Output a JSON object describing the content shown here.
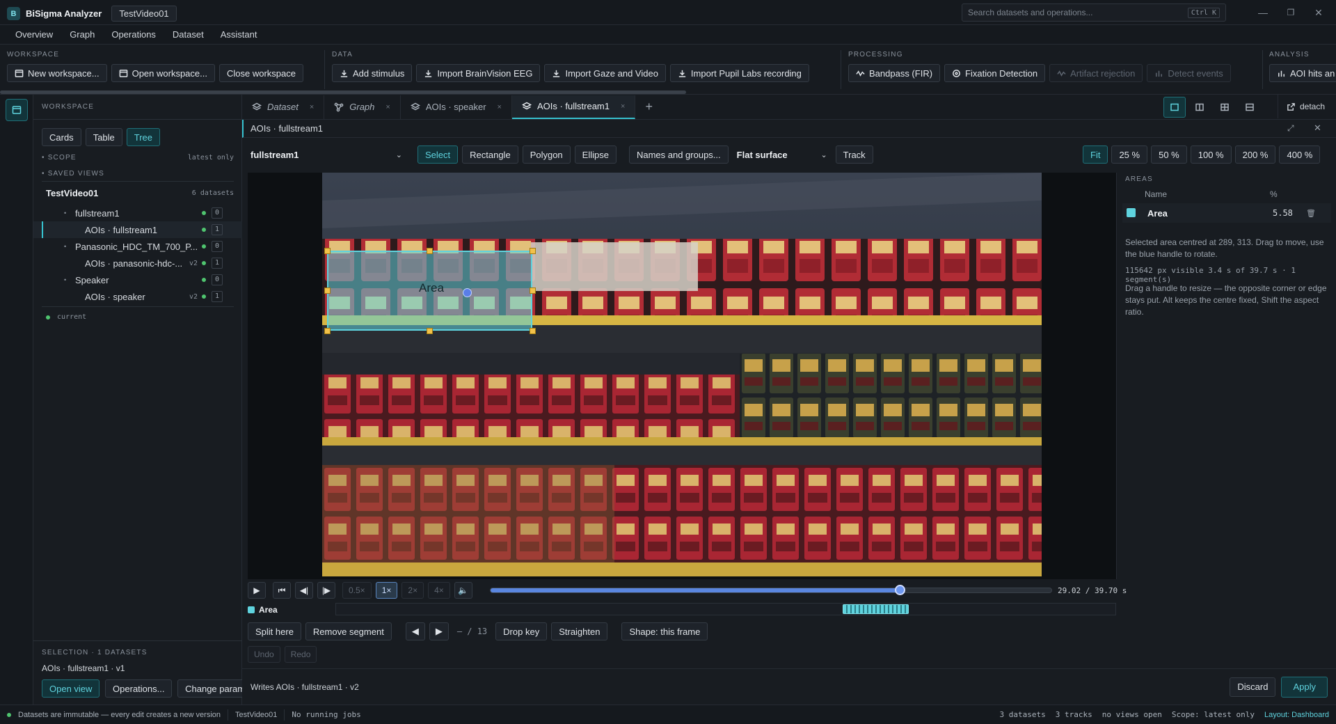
{
  "app": {
    "logo": "B",
    "name": "BiSigma Analyzer",
    "project": "TestVideo01",
    "search_placeholder": "Search datasets and operations...",
    "search_shortcut": "Ctrl K"
  },
  "menu": [
    "Overview",
    "Graph",
    "Operations",
    "Dataset",
    "Assistant"
  ],
  "toolbar": {
    "workspace": {
      "label": "WORKSPACE",
      "buttons": [
        "New workspace...",
        "Open workspace...",
        "Close workspace"
      ]
    },
    "data": {
      "label": "DATA",
      "buttons": [
        "Add stimulus",
        "Import BrainVision EEG",
        "Import Gaze and Video",
        "Import Pupil Labs recording"
      ]
    },
    "processing": {
      "label": "PROCESSING",
      "buttons": [
        "Bandpass (FIR)",
        "Fixation Detection",
        "Artifact rejection",
        "Detect events"
      ]
    },
    "analysis": {
      "label": "ANALYSIS",
      "buttons": [
        "AOI hits an"
      ]
    }
  },
  "sidebar": {
    "label": "WORKSPACE",
    "view_tabs": [
      "Cards",
      "Table",
      "Tree"
    ],
    "scope_label": "SCOPE",
    "scope_value": "latest only",
    "saved_views_label": "SAVED VIEWS",
    "root": {
      "name": "TestVideo01",
      "count": "6 datasets"
    },
    "items": [
      {
        "name": "fullstream1",
        "level": 1,
        "version": "",
        "count": "0"
      },
      {
        "name": "AOIs · fullstream1",
        "level": 2,
        "version": "",
        "count": "1"
      },
      {
        "name": "Panasonic_HDC_TM_700_P...",
        "level": 1,
        "version": "",
        "count": "0"
      },
      {
        "name": "AOIs · panasonic-hdc-...",
        "level": 2,
        "version": "v2",
        "count": "1"
      },
      {
        "name": "Speaker",
        "level": 1,
        "version": "",
        "count": "0"
      },
      {
        "name": "AOIs · speaker",
        "level": 2,
        "version": "v2",
        "count": "1"
      }
    ],
    "legend": "current",
    "selection_label": "SELECTION · 1 DATASETS",
    "selection_item": "AOIs · fullstream1 · v1",
    "selection_buttons": [
      "Open view",
      "Operations...",
      "Change param"
    ]
  },
  "tabs": [
    {
      "label": "Dataset",
      "icon": "layers-icon"
    },
    {
      "label": "Graph",
      "icon": "graph-icon"
    },
    {
      "label": "AOIs · speaker",
      "icon": "layers-icon"
    },
    {
      "label": "AOIs · fullstream1",
      "icon": "layers-icon"
    }
  ],
  "tab_detach": "detach",
  "panel": {
    "title": "AOIs · fullstream1",
    "stream_select": "fullstream1",
    "tools": [
      "Select",
      "Rectangle",
      "Polygon",
      "Ellipse"
    ],
    "names_button": "Names and groups...",
    "surface_select": "Flat surface",
    "track_button": "Track",
    "zoom": [
      "Fit",
      "25 %",
      "50 %",
      "100 %",
      "200 %",
      "400 %"
    ]
  },
  "aoi": {
    "label": "Area",
    "color": "#5fd3de"
  },
  "areas": {
    "label": "AREAS",
    "col_name": "Name",
    "col_pct": "%",
    "rows": [
      {
        "name": "Area",
        "pct": "5.58",
        "color": "#5fd3de"
      }
    ],
    "info1": "Selected area centred at 289, 313. Drag to move, use the blue handle to rotate.",
    "info2": "115642 px  visible 3.4 s of 39.7 s · 1 segment(s)",
    "info3": "Drag a handle to resize — the opposite corner or edge stays put. Alt keeps the centre fixed, Shift the aspect ratio."
  },
  "playback": {
    "speeds": [
      "0.5×",
      "1×",
      "2×",
      "4×"
    ],
    "time": "29.02 / 39.70 s",
    "progress": 0.731
  },
  "timeline": {
    "label": "Area",
    "segments": [
      0.65,
      0.735
    ]
  },
  "segment_buttons": [
    "Split here",
    "Remove segment"
  ],
  "key_counter": "– / 13",
  "key_buttons": [
    "Drop key",
    "Straighten",
    "Shape: this frame"
  ],
  "history": [
    "Undo",
    "Redo"
  ],
  "footer": {
    "writes": "Writes AOIs · fullstream1 · v2",
    "discard": "Discard",
    "apply": "Apply"
  },
  "statusbar": {
    "message": "Datasets are immutable — every edit creates a new version",
    "project": "TestVideo01",
    "jobs": "No running jobs",
    "datasets": "3 datasets",
    "tracks": "3 tracks",
    "views": "no views open",
    "scope": "Scope: latest only",
    "layout": "Layout: Dashboard"
  }
}
